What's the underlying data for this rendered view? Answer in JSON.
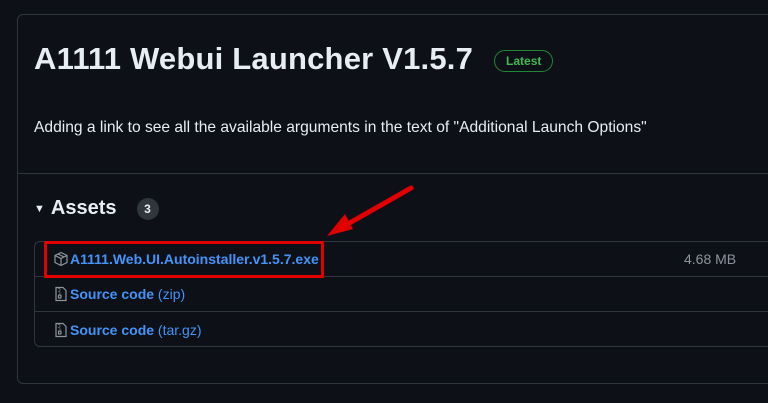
{
  "release": {
    "title": "A1111 Webui Launcher V1.5.7",
    "badge": "Latest",
    "description": "Adding a link to see all the available arguments in the text of \"Additional Launch Options\""
  },
  "assets": {
    "label": "Assets",
    "count": "3",
    "items": [
      {
        "name": "A1111.Web.UI.Autoinstaller.v1.5.7.exe",
        "size": "4.68 MB",
        "icon": "package-icon"
      },
      {
        "name": "Source code",
        "suffix": "(zip)",
        "icon": "file-zip-icon"
      },
      {
        "name": "Source code",
        "suffix": "(tar.gz)",
        "icon": "file-zip-icon"
      }
    ]
  },
  "annotation": {
    "highlight_color": "#e10000",
    "arrow_color": "#e10000"
  },
  "colors": {
    "background": "#0d1117",
    "border": "#30363d",
    "link": "#4493f8",
    "badge_green": "#3fb950"
  }
}
